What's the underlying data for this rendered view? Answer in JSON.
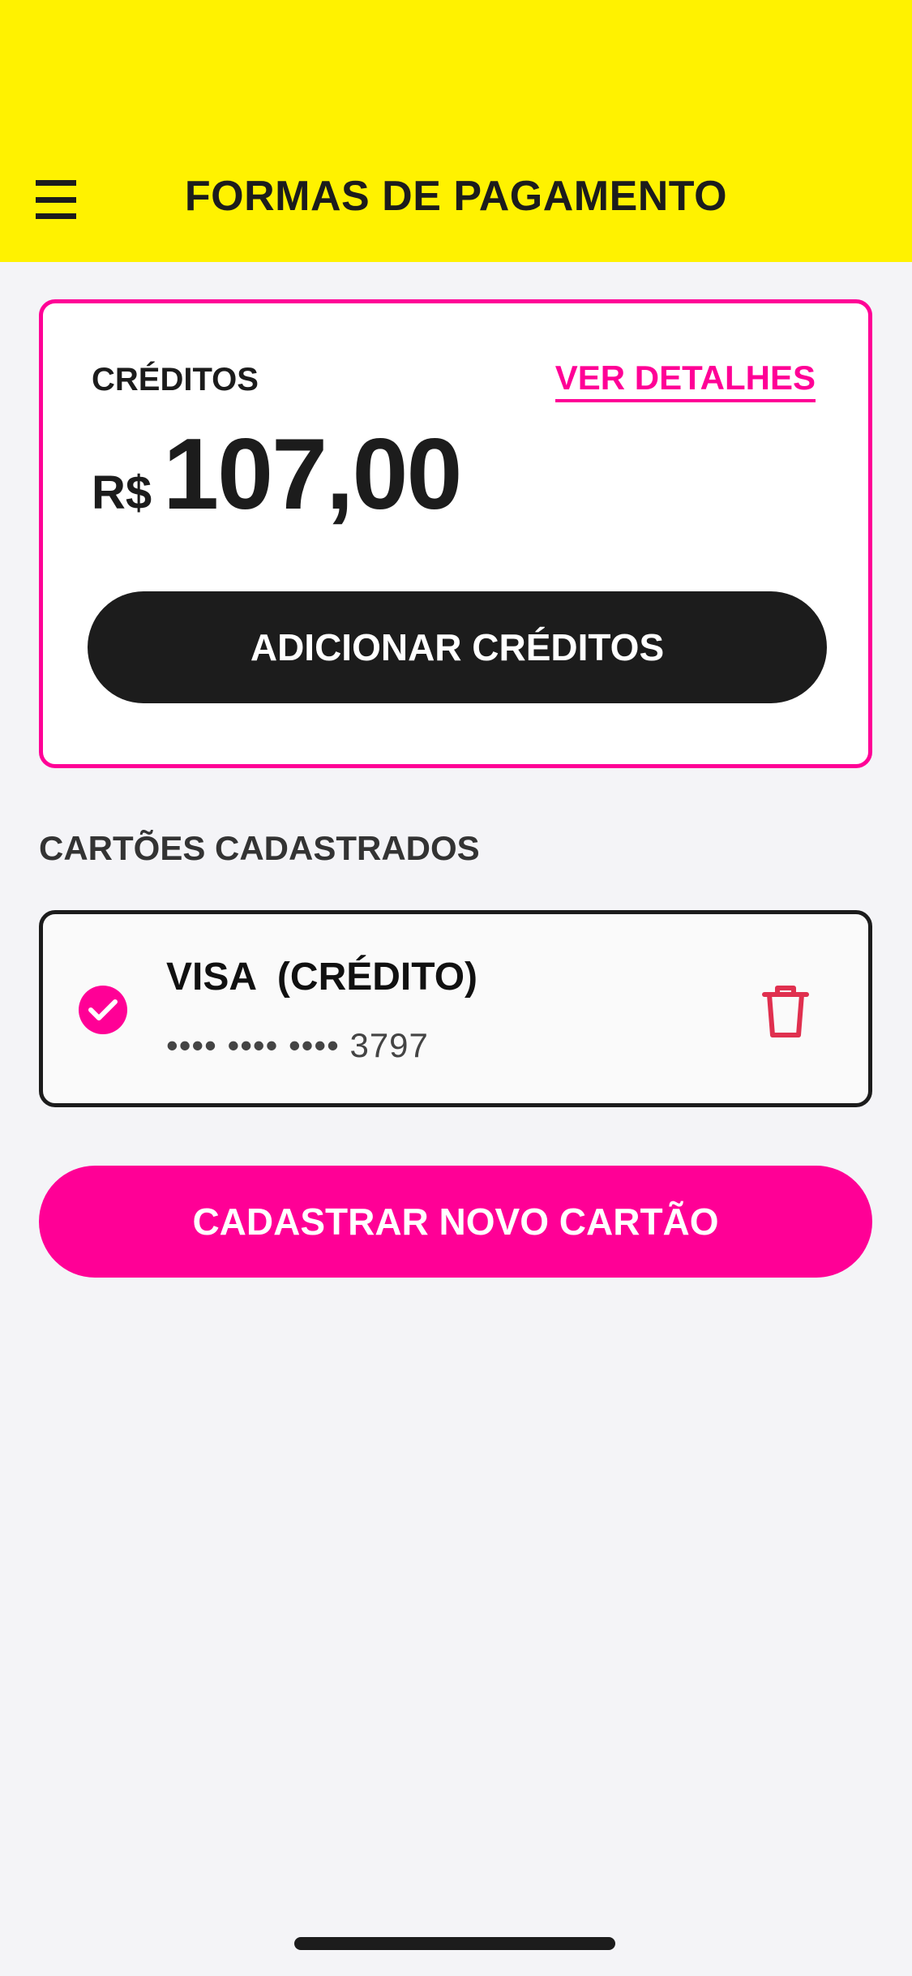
{
  "header": {
    "title": "FORMAS DE PAGAMENTO",
    "menu_icon": "hamburger-menu-icon",
    "background": "#fff200"
  },
  "credits": {
    "label": "CRÉDITOS",
    "details_link": "VER DETALHES",
    "currency": "R$",
    "amount": "107,00",
    "add_button": "ADICIONAR CRÉDITOS",
    "border_color": "#ff0096"
  },
  "cards_section": {
    "title": "CARTÕES CADASTRADOS",
    "cards": [
      {
        "name": "VISA  (CRÉDITO)",
        "number_masked": "•••• •••• •••• 3797",
        "selected": true,
        "selected_icon": "check-circle-icon",
        "delete_icon": "trash-icon"
      }
    ]
  },
  "new_card_button": "CADASTRAR NOVO CARTÃO",
  "colors": {
    "accent": "#ff0096",
    "dark": "#1c1c1c",
    "background": "#f4f4f7",
    "delete_icon": "#e0304f"
  }
}
